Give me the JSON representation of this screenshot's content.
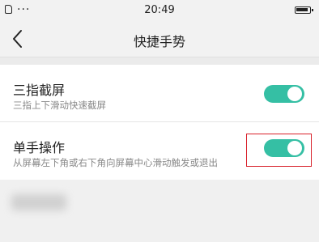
{
  "status_bar": {
    "time": "20:49",
    "left_icons": [
      "sim-icon",
      "dots-icon"
    ],
    "dots": "···",
    "right_icon": "battery-icon"
  },
  "header": {
    "title": "快捷手势",
    "back_icon": "chevron-left-icon"
  },
  "settings": [
    {
      "title": "三指截屏",
      "description": "三指上下滑动快速截屏",
      "enabled": true
    },
    {
      "title": "单手操作",
      "description": "从屏幕左下角或右下角向屏幕中心滑动触发或退出",
      "enabled": true
    }
  ],
  "colors": {
    "toggle_on": "#35bfa4",
    "highlight": "#d8202a",
    "background": "#f0f0f0"
  }
}
